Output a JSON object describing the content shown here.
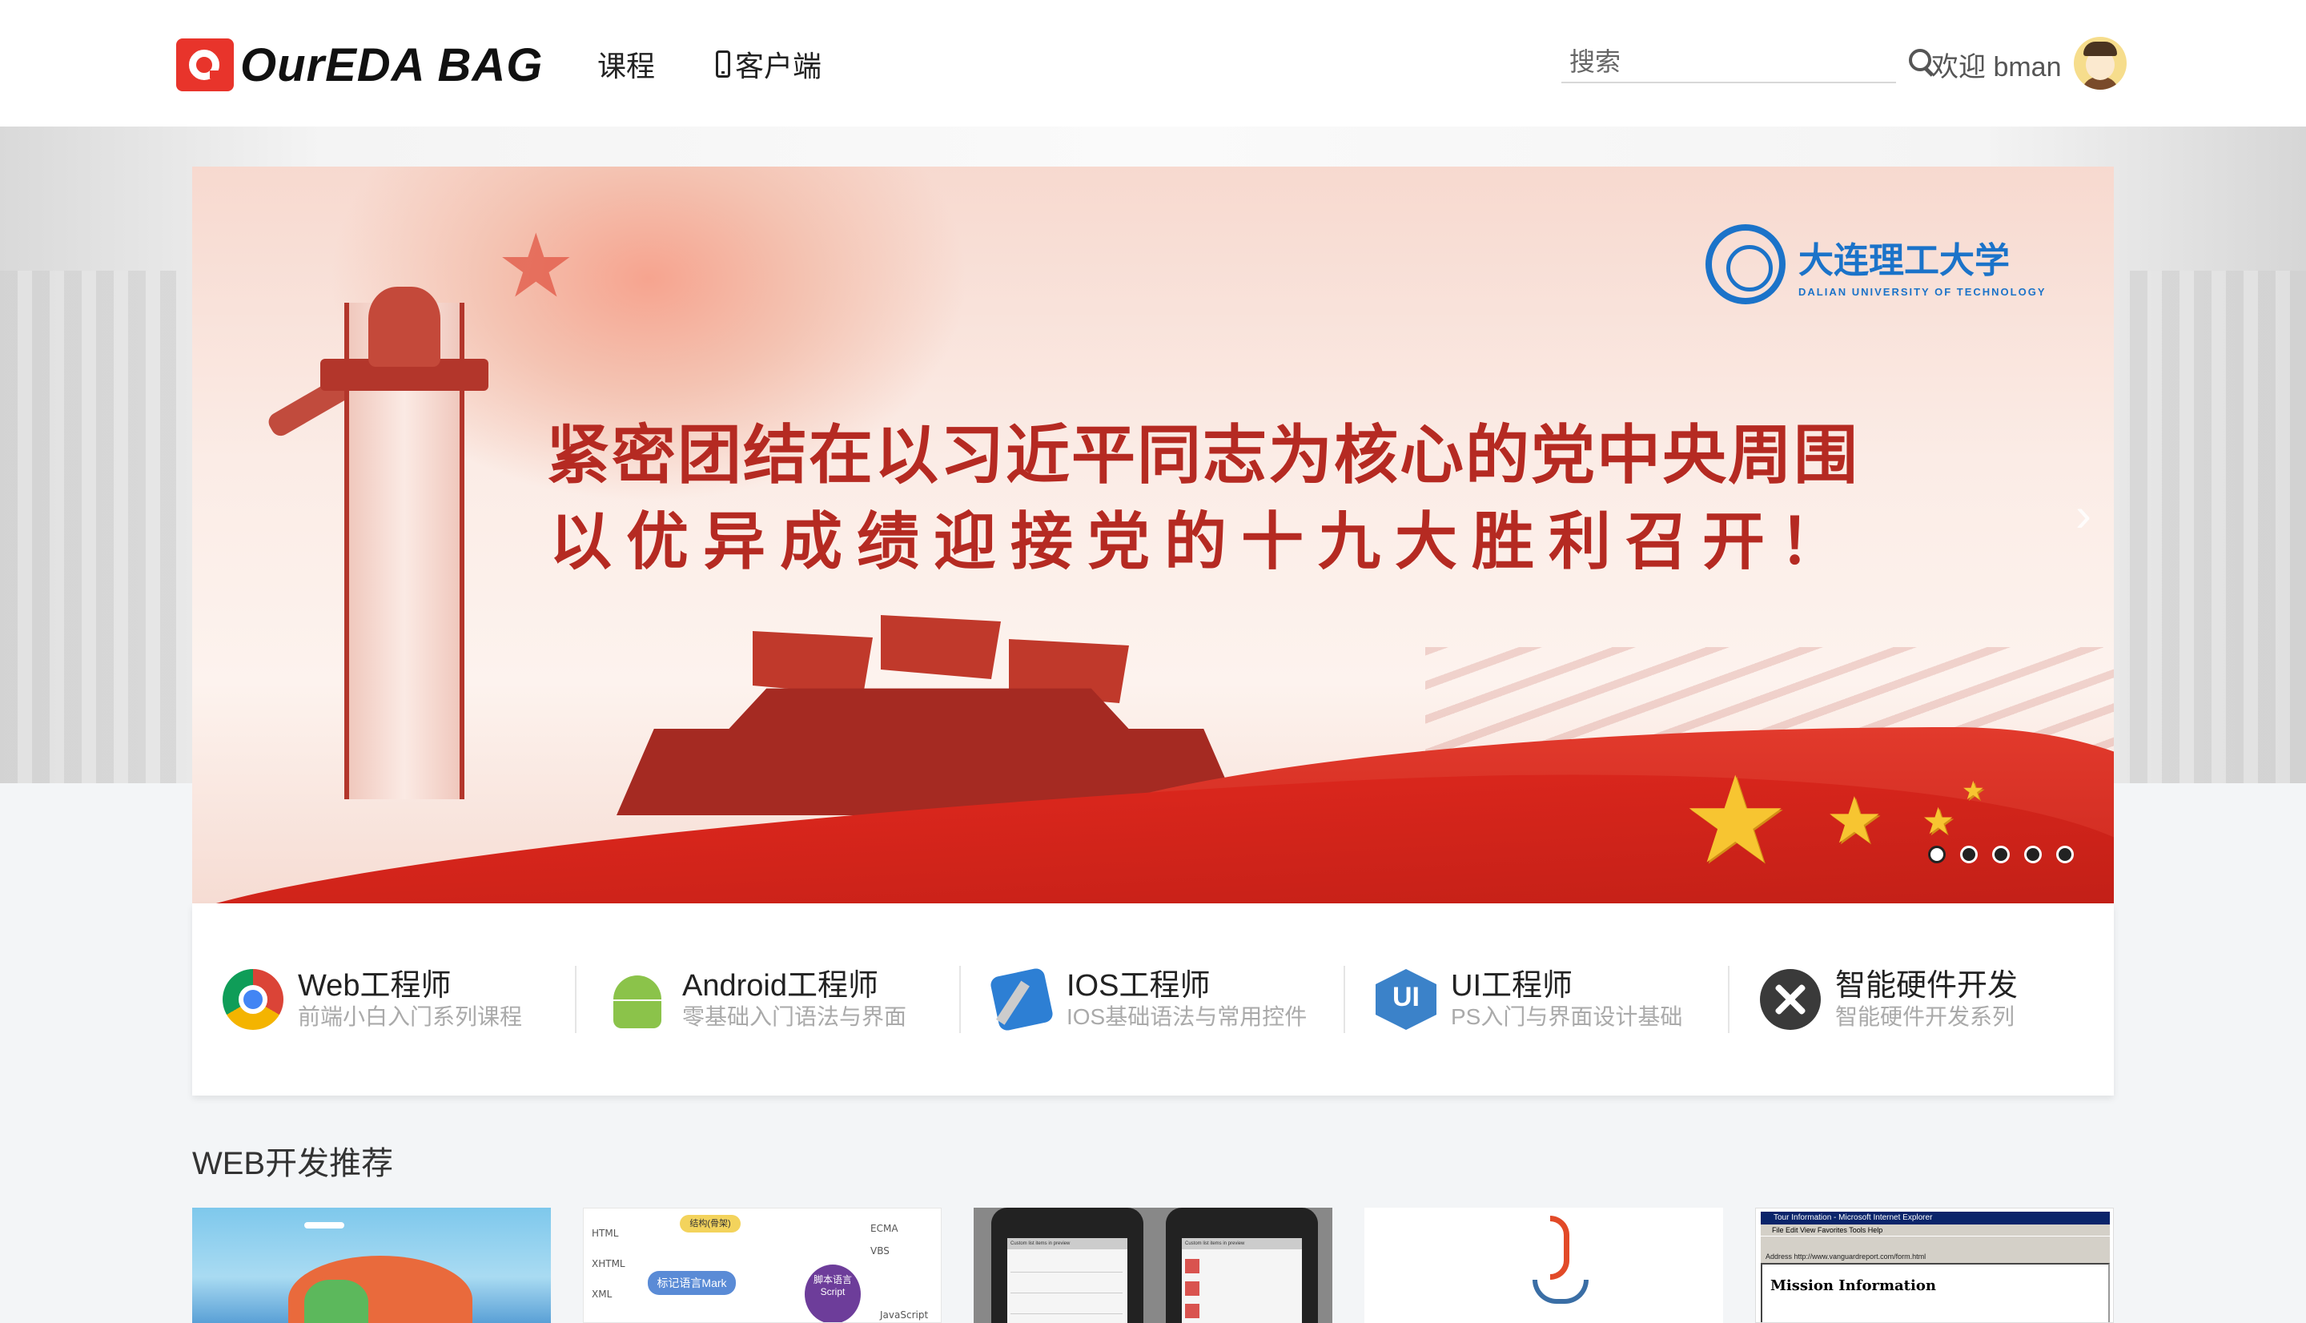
{
  "header": {
    "logo_text": "OurEDA BAG",
    "nav": {
      "courses": "课程",
      "client": "客户端"
    },
    "search_placeholder": "搜索",
    "welcome": "欢迎 bman"
  },
  "banner": {
    "university_name": "大连理工大学",
    "university_sub": "DALIAN UNIVERSITY OF TECHNOLOGY",
    "slogan_line1": "紧密团结在以习近平同志为核心的党中央周围",
    "slogan_line2": "以优异成绩迎接党的十九大胜利召开！",
    "arrow": "›",
    "slide_count": 5,
    "active_slide": 1
  },
  "categories": [
    {
      "title": "Web工程师",
      "subtitle": "前端小白入门系列课程",
      "icon": "chrome-icon"
    },
    {
      "title": "Android工程师",
      "subtitle": "零基础入门语法与界面",
      "icon": "android-icon"
    },
    {
      "title": "IOS工程师",
      "subtitle": "IOS基础语法与常用控件",
      "icon": "ios-dev-icon"
    },
    {
      "title": "UI工程师",
      "subtitle": "PS入门与界面设计基础",
      "icon": "ui-icon"
    },
    {
      "title": "智能硬件开发",
      "subtitle": "智能硬件开发系列",
      "icon": "tools-icon"
    }
  ],
  "ui_icon_text": "UI",
  "section": {
    "title": "WEB开发推荐",
    "thumb2": {
      "html": "HTML",
      "xhtml": "XHTML",
      "xml": "XML",
      "markup": "标记语言Mark",
      "structure": "结构(骨架)",
      "script_cn": "脚本语言",
      "script": "Script",
      "javascript": "JavaScript",
      "ecma": "ECMA",
      "vbs": "VBS"
    },
    "thumb3": {
      "bar_left": "Custom list items in preview",
      "bar_right": "Custom list items in preview"
    },
    "thumb5": {
      "window_title": "Tour Information - Microsoft Internet Explorer",
      "menu": "File   Edit   View   Favorites   Tools   Help",
      "address": "Address  http://www.vanguardreport.com/form.html",
      "heading": "Mission Information"
    }
  }
}
